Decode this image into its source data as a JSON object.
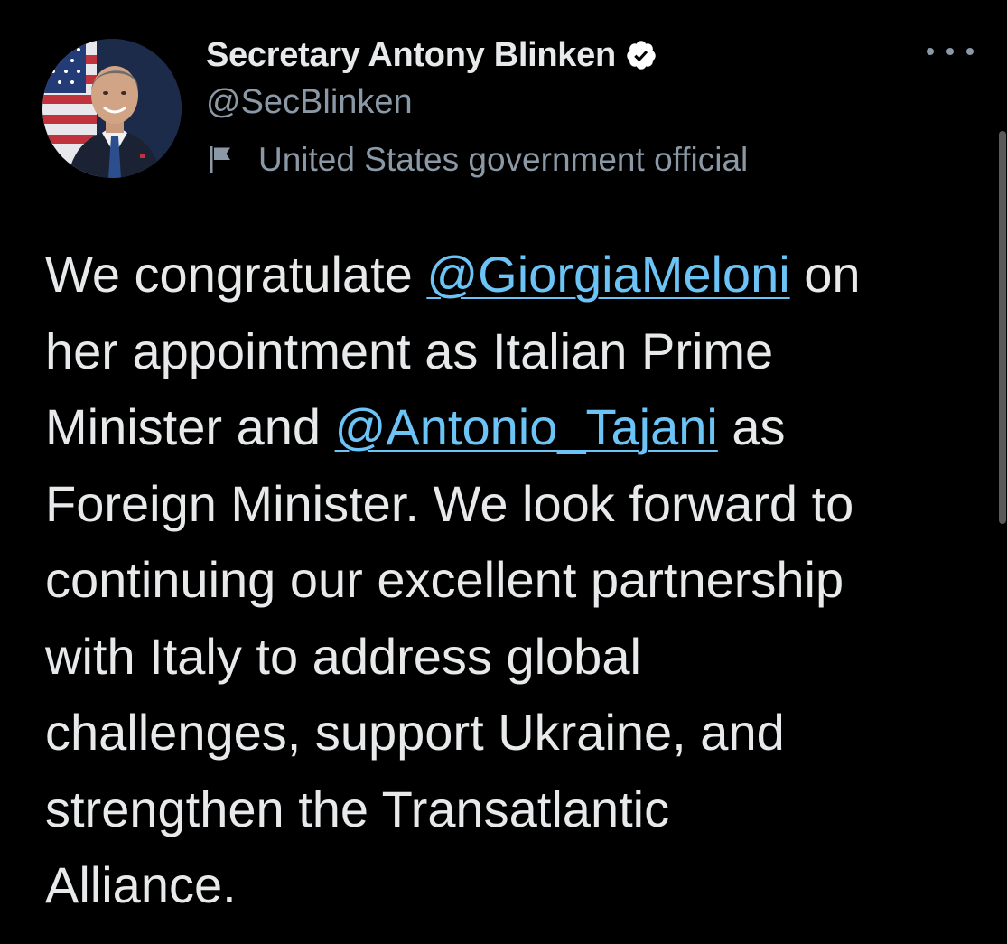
{
  "author": {
    "display_name": "Secretary Antony Blinken",
    "handle": "@SecBlinken",
    "label": "United States government official",
    "verified": true
  },
  "tweet": {
    "lines": [
      [
        {
          "t": "We congratulate "
        },
        {
          "t": "@GiorgiaMeloni",
          "mention": true
        },
        {
          "t": " on"
        }
      ],
      [
        {
          "t": "her appointment as Italian Prime"
        }
      ],
      [
        {
          "t": "Minister and "
        },
        {
          "t": "@Antonio_Tajani",
          "mention": true
        },
        {
          "t": " as"
        }
      ],
      [
        {
          "t": "Foreign Minister. We look forward to"
        }
      ],
      [
        {
          "t": "continuing our excellent partnership"
        }
      ],
      [
        {
          "t": "with Italy to address global"
        }
      ],
      [
        {
          "t": "challenges, support Ukraine, and"
        }
      ],
      [
        {
          "t": "strengthen the Transatlantic"
        }
      ],
      [
        {
          "t": "Alliance."
        }
      ]
    ]
  },
  "icons": {
    "verified": "verified-badge-icon",
    "label": "flag-icon",
    "more": "more-options-icon"
  },
  "colors": {
    "background": "#000000",
    "text": "#e7e9ea",
    "secondary": "#8b98a5",
    "mention": "#6cc3f5"
  }
}
